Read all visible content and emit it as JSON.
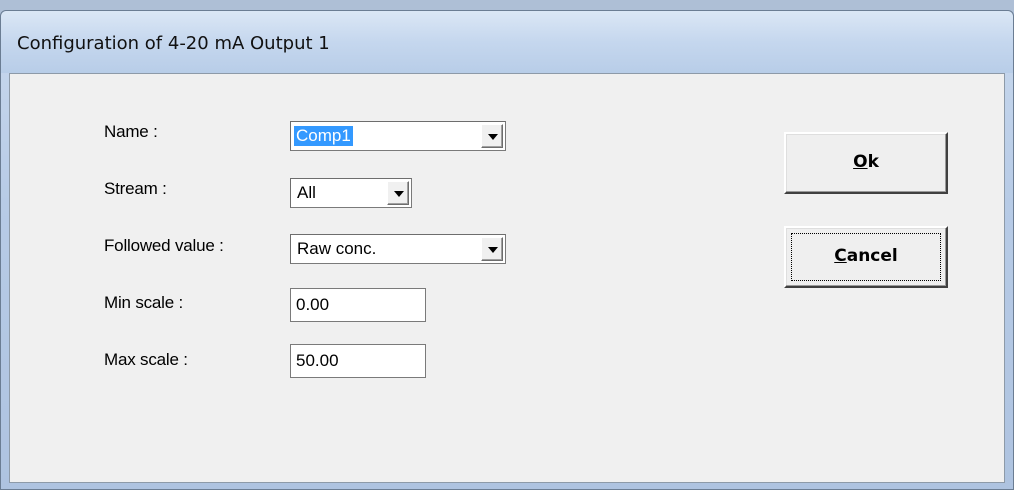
{
  "window": {
    "title": "Configuration of 4-20 mA Output 1"
  },
  "form": {
    "name": {
      "label": "Name :",
      "value": "Comp1"
    },
    "stream": {
      "label": "Stream :",
      "value": "All"
    },
    "followed_value": {
      "label": "Followed value :",
      "value": "Raw conc."
    },
    "min_scale": {
      "label": "Min scale :",
      "value": "0.00"
    },
    "max_scale": {
      "label": "Max scale :",
      "value": "50.00"
    }
  },
  "buttons": {
    "ok": {
      "mnemonic": "O",
      "rest": "k"
    },
    "cancel": {
      "mnemonic": "C",
      "rest": "ancel"
    }
  }
}
